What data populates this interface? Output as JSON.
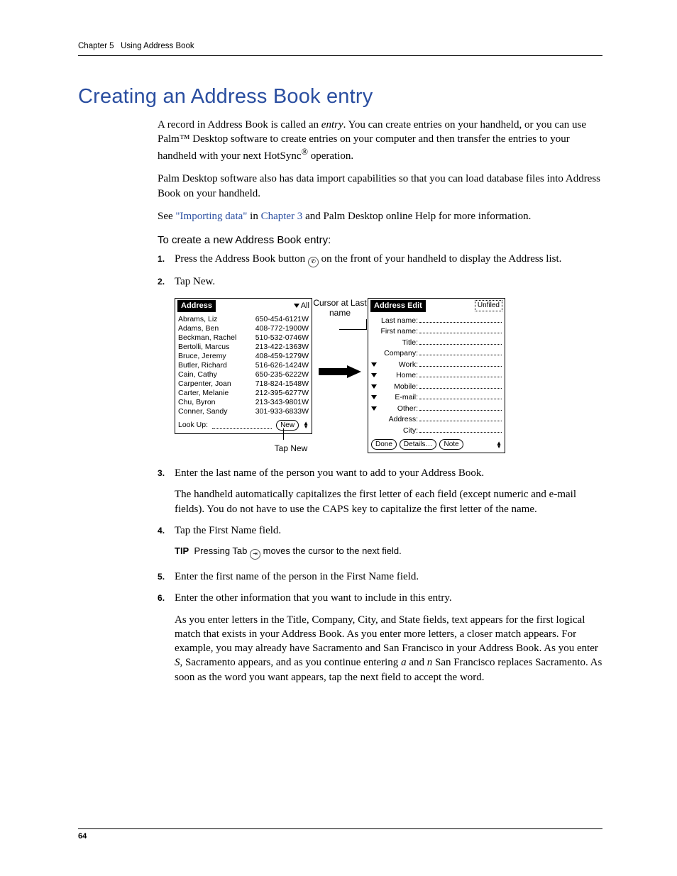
{
  "header": {
    "chapter_label": "Chapter 5",
    "chapter_title": "Using Address Book"
  },
  "title": "Creating an Address Book entry",
  "intro": {
    "p1_a": "A record in Address Book is called an ",
    "p1_em": "entry",
    "p1_b": ". You can create entries on your handheld, or you can use Palm™ Desktop software to create entries on your computer and then transfer the entries to your handheld with your next HotSync",
    "p1_c": " operation.",
    "p2": "Palm Desktop software also has data import capabilities so that you can load database files into Address Book on your handheld.",
    "p3_a": "See ",
    "p3_link1": "\"Importing data\"",
    "p3_b": " in ",
    "p3_link2": "Chapter 3",
    "p3_c": " and Palm Desktop online Help for more information."
  },
  "subhead": "To create a new Address Book entry:",
  "steps": {
    "s1_a": "Press the Address Book button ",
    "s1_b": " on the front of your handheld to display the Address list.",
    "s2": "Tap New.",
    "s3": "Enter the last name of the person you want to add to your Address Book.",
    "s3_sub": "The handheld automatically capitalizes the first letter of each field (except numeric and e-mail fields). You do not have to use the CAPS key to capitalize the first letter of the name.",
    "s4": "Tap the First Name field.",
    "tip_label": "TIP",
    "tip_a": "Pressing Tab ",
    "tip_b": " moves the cursor to the next field.",
    "s5": "Enter the first name of the person in the First Name field.",
    "s6": "Enter the other information that you want to include in this entry.",
    "s6_sub_a": "As you enter letters in the Title, Company, City, and State fields, text appears for the first logical match that exists in your Address Book. As you enter more letters, a closer match appears. For example, you may already have Sacramento and San Francisco in your Address Book. As you enter ",
    "s6_sub_em1": "S",
    "s6_sub_b": ", Sacramento appears, and as you continue entering ",
    "s6_sub_em2": "a",
    "s6_sub_c": " and ",
    "s6_sub_em3": "n",
    "s6_sub_d": " San Francisco replaces Sacramento. As soon as the word you want appears, tap the next field to accept the word."
  },
  "figure": {
    "callout_cursor": "Cursor at Last name",
    "callout_tapnew": "Tap New",
    "list_screen": {
      "title": "Address",
      "category": "All",
      "rows": [
        {
          "name": "Abrams, Liz",
          "phone": "650-454-6121W"
        },
        {
          "name": "Adams, Ben",
          "phone": "408-772-1900W"
        },
        {
          "name": "Beckman, Rachel",
          "phone": "510-532-0746W"
        },
        {
          "name": "Bertolli, Marcus",
          "phone": "213-422-1363W"
        },
        {
          "name": "Bruce, Jeremy",
          "phone": "408-459-1279W"
        },
        {
          "name": "Butler, Richard",
          "phone": "516-626-1424W"
        },
        {
          "name": "Cain, Cathy",
          "phone": "650-235-6222W"
        },
        {
          "name": "Carpenter, Joan",
          "phone": "718-824-1548W"
        },
        {
          "name": "Carter, Melanie",
          "phone": "212-395-6277W"
        },
        {
          "name": "Chu, Byron",
          "phone": "213-343-9801W"
        },
        {
          "name": "Conner, Sandy",
          "phone": "301-933-6833W"
        }
      ],
      "lookup_label": "Look Up:",
      "new_btn": "New"
    },
    "edit_screen": {
      "title": "Address Edit",
      "category": "Unfiled",
      "fields": [
        {
          "label": "Last name:",
          "tri": false
        },
        {
          "label": "First name:",
          "tri": false
        },
        {
          "label": "Title:",
          "tri": false
        },
        {
          "label": "Company:",
          "tri": false
        },
        {
          "label": "Work:",
          "tri": true
        },
        {
          "label": "Home:",
          "tri": true
        },
        {
          "label": "Mobile:",
          "tri": true
        },
        {
          "label": "E-mail:",
          "tri": true
        },
        {
          "label": "Other:",
          "tri": true
        },
        {
          "label": "Address:",
          "tri": false
        },
        {
          "label": "City:",
          "tri": false
        }
      ],
      "done_btn": "Done",
      "details_btn": "Details…",
      "note_btn": "Note"
    }
  },
  "page_number": "64"
}
